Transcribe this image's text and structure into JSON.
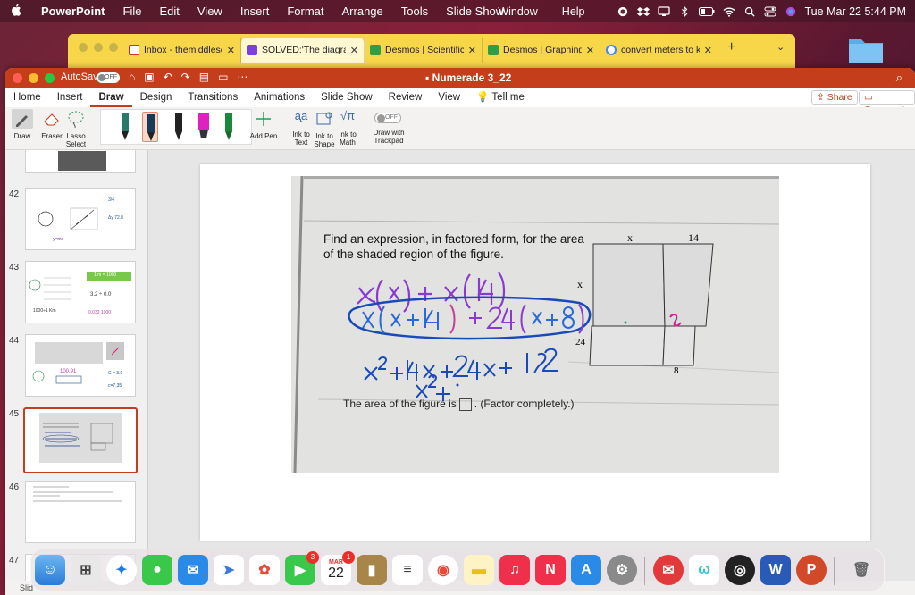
{
  "menubar": {
    "app_name": "PowerPoint",
    "items": [
      "File",
      "Edit",
      "View",
      "Insert",
      "Format",
      "Arrange",
      "Tools",
      "Slide Show"
    ],
    "right_items": [
      "Window",
      "Help"
    ],
    "datetime": "Tue Mar 22  5:44 PM"
  },
  "browser": {
    "tabs": [
      {
        "title": "Inbox - themiddleschoo",
        "icon": "gmail-icon",
        "color": "#d93025"
      },
      {
        "title": "SOLVED:'The diagram s",
        "icon": "numerade-icon",
        "color": "#7b3fe4"
      },
      {
        "title": "Desmos | Scientific Calc",
        "icon": "desmos-icon",
        "color": "#2f9e44"
      },
      {
        "title": "Desmos | Graphing Calc",
        "icon": "desmos-icon",
        "color": "#2f9e44"
      },
      {
        "title": "convert meters to kilon",
        "icon": "google-icon",
        "color": "#4285f4"
      }
    ],
    "active_tab_index": 1
  },
  "ppt": {
    "autosave_label": "AutoSave",
    "autosave_state": "OFF",
    "doc_title": "Numerade 3_22",
    "ribbon_tabs": [
      "Home",
      "Insert",
      "Draw",
      "Design",
      "Transitions",
      "Animations",
      "Slide Show",
      "Review",
      "View"
    ],
    "active_ribbon_tab": "Draw",
    "tell_me": "Tell me",
    "share": "Share",
    "comments": "Comments",
    "tools": {
      "draw": "Draw",
      "eraser": "Eraser",
      "lasso": "Lasso Select",
      "add_pen": "Add Pen",
      "ink_to_text": "Ink to Text",
      "ink_to_shape": "Ink to Shape",
      "ink_to_math": "Ink to Math",
      "draw_with_trackpad": "Draw with Trackpad",
      "trackpad_state": "OFF"
    },
    "pens": [
      {
        "color": "#2a7a6a"
      },
      {
        "color": "#1a3a5a"
      },
      {
        "color": "#222222"
      },
      {
        "color": "#e020c0"
      },
      {
        "color": "#1a8a3a"
      }
    ],
    "selected_pen": 1,
    "slide_numbers": [
      "42",
      "43",
      "44",
      "45",
      "46",
      "47"
    ],
    "active_slide": "45",
    "thumb_43_text": "1 m = 1000",
    "status_left": "Slid"
  },
  "slide": {
    "problem": "Find an expression, in factored form, for the area of the shaded region of the figure.",
    "area_prefix": "The area of the figure is",
    "area_suffix": ". (Factor completely.)",
    "figure_labels": {
      "top_left": "x",
      "top_right": "14",
      "left": "x",
      "bottom_left": "24",
      "bottom_right": "8"
    },
    "handwriting": {
      "line1": "x(x) + x(14)",
      "line2": "x(x+14) + 24(x+8)",
      "line3": "x² + 14x + 24x + 192",
      "line4": "x² +"
    }
  },
  "dock": {
    "calendar_month": "MAR",
    "calendar_day": "22",
    "facetime_badge": "3",
    "calendar_badge": "1"
  }
}
